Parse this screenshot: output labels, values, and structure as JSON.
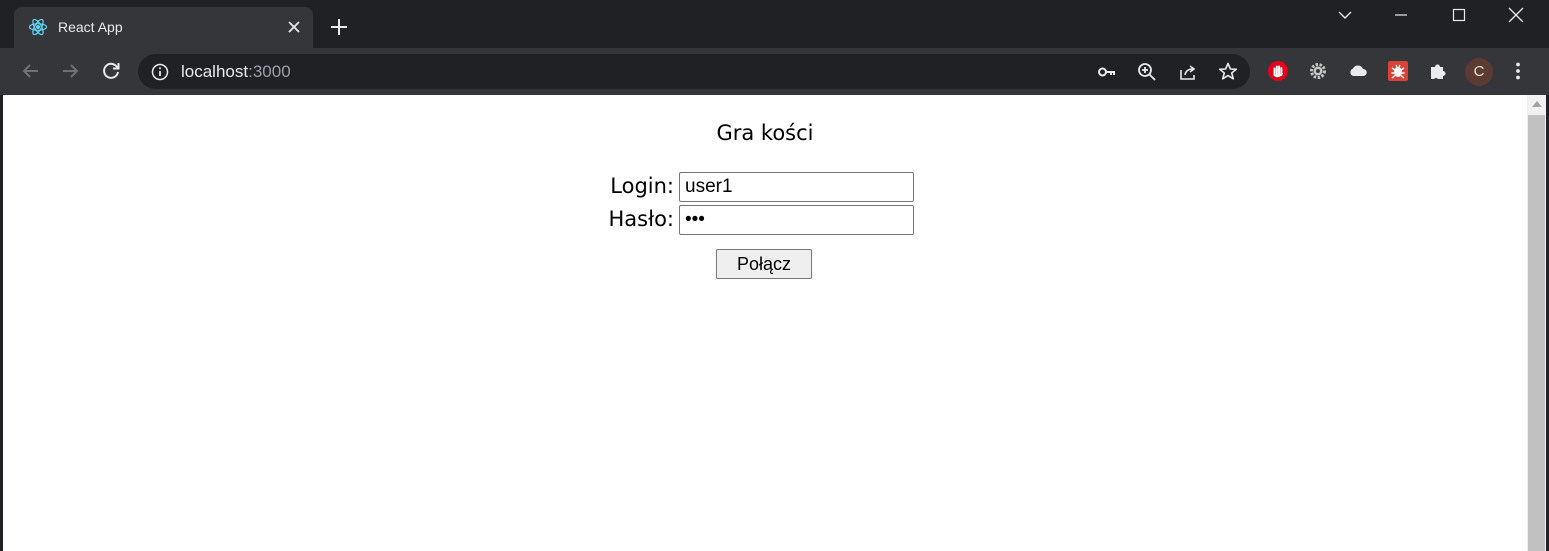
{
  "tab": {
    "title": "React App"
  },
  "address_bar": {
    "host": "localhost",
    "port": ":3000"
  },
  "profile": {
    "initial": "C"
  },
  "page": {
    "title": "Gra kości",
    "login_label": "Login:",
    "login_value": "user1",
    "password_label": "Hasło:",
    "password_value": "abc",
    "submit_label": "Połącz"
  },
  "icons": {
    "favicon": "react-icon",
    "extensions": [
      "adblock-icon",
      "gear-icon",
      "cloud-icon",
      "bug-icon",
      "puzzle-icon"
    ]
  },
  "colors": {
    "frame": "#202124",
    "toolbar": "#35363a",
    "react": "#61dafb",
    "adblock": "#e3001b"
  }
}
